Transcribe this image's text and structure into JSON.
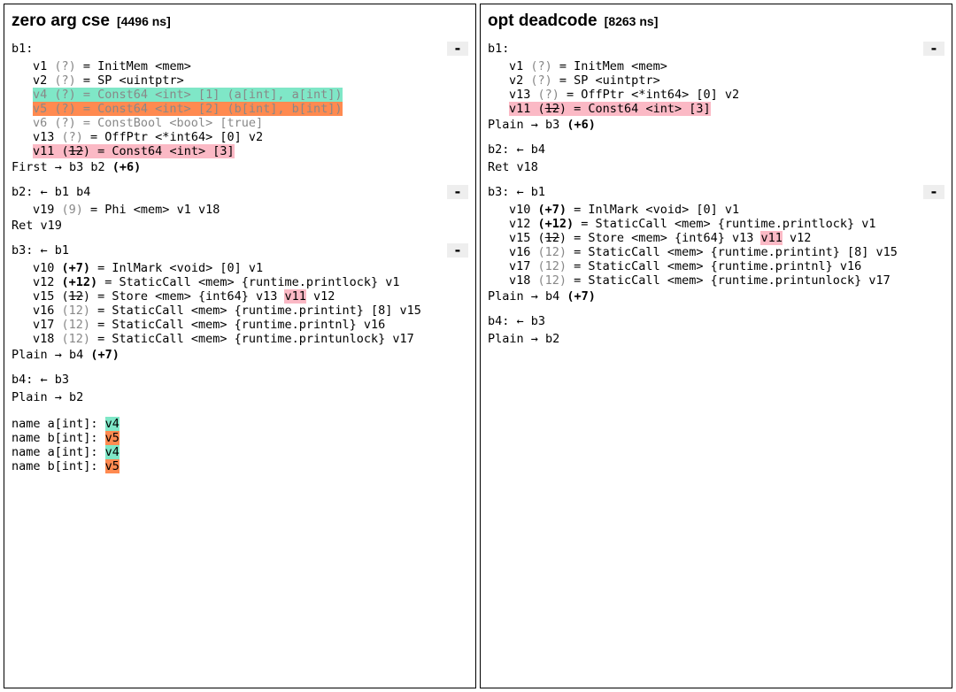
{
  "left": {
    "title": "zero arg cse",
    "time": "[4496 ns]",
    "b1": {
      "header": "b1:",
      "collapse": "-",
      "lines": [
        [
          {
            "t": "v1 "
          },
          {
            "t": "(?)",
            "dead": true
          },
          {
            "t": " = InitMem <mem>"
          }
        ],
        [
          {
            "t": "v2 "
          },
          {
            "t": "(?)",
            "dead": true
          },
          {
            "t": " = SP <uintptr>"
          }
        ],
        [
          {
            "t": "v4 (?) = Const64 <int> [1] (a[int], a[int])",
            "hl": "green",
            "dead": true
          }
        ],
        [
          {
            "t": "v5 (?) = Const64 <int> [2] (b[int], b[int])",
            "hl": "orange",
            "dead": true
          }
        ],
        [
          {
            "t": "v6 (?) = ConstBool <bool> [true]",
            "dead": true
          }
        ],
        [
          {
            "t": "v13 "
          },
          {
            "t": "(?)",
            "dead": true
          },
          {
            "t": " = OffPtr <*int64> [0] v2"
          }
        ],
        [
          {
            "t": "v11 ("
          },
          {
            "t": "12",
            "strike": true
          },
          {
            "t": ") = Const64 <int> [3]",
            "hl": "pink",
            "wrap": "pink"
          }
        ],
        [
          {
            "t": "First → b3 b2 ",
            "footer": true
          },
          {
            "t": "(+6)",
            "bold": true
          }
        ]
      ]
    },
    "b2": {
      "header": "b2: ← b1 b4",
      "collapse": "-",
      "lines": [
        [
          {
            "t": "v19 "
          },
          {
            "t": "(9)",
            "dead": true
          },
          {
            "t": " = Phi <mem> v1 v18"
          }
        ],
        [
          {
            "t": "Ret v19",
            "footer": true
          }
        ]
      ]
    },
    "b3": {
      "header": "b3: ← b1",
      "collapse": "-",
      "lines": [
        [
          {
            "t": "v10 "
          },
          {
            "t": "(+7)",
            "bold": true
          },
          {
            "t": " = InlMark <void> [0] v1"
          }
        ],
        [
          {
            "t": "v12 "
          },
          {
            "t": "(+12)",
            "bold": true
          },
          {
            "t": " = StaticCall <mem> {runtime.printlock} v1"
          }
        ],
        [
          {
            "t": "v15 ("
          },
          {
            "t": "12",
            "strike": true
          },
          {
            "t": ") = Store <mem> {int64} v13 "
          },
          {
            "t": "v11",
            "hl": "pink"
          },
          {
            "t": " v12"
          }
        ],
        [
          {
            "t": "v16 "
          },
          {
            "t": "(12)",
            "dead": true
          },
          {
            "t": " = StaticCall <mem> {runtime.printint} [8] v15"
          }
        ],
        [
          {
            "t": "v17 "
          },
          {
            "t": "(12)",
            "dead": true
          },
          {
            "t": " = StaticCall <mem> {runtime.printnl} v16"
          }
        ],
        [
          {
            "t": "v18 "
          },
          {
            "t": "(12)",
            "dead": true
          },
          {
            "t": " = StaticCall <mem> {runtime.printunlock} v17"
          }
        ],
        [
          {
            "t": "Plain → b4 ",
            "footer": true
          },
          {
            "t": "(+7)",
            "bold": true
          }
        ]
      ]
    },
    "b4": {
      "header": "b4: ← b3",
      "lines": [
        [
          {
            "t": "Plain → b2",
            "footer": true
          }
        ]
      ]
    },
    "names": [
      {
        "label": "name a[int]: ",
        "chip": "v4",
        "hl": "green"
      },
      {
        "label": "name b[int]: ",
        "chip": "v5",
        "hl": "orange"
      },
      {
        "label": "name a[int]: ",
        "chip": "v4",
        "hl": "green"
      },
      {
        "label": "name b[int]: ",
        "chip": "v5",
        "hl": "orange"
      }
    ]
  },
  "right": {
    "title": "opt deadcode",
    "time": "[8263 ns]",
    "b1": {
      "header": "b1:",
      "collapse": "-",
      "lines": [
        [
          {
            "t": "v1 "
          },
          {
            "t": "(?)",
            "dead": true
          },
          {
            "t": " = InitMem <mem>"
          }
        ],
        [
          {
            "t": "v2 "
          },
          {
            "t": "(?)",
            "dead": true
          },
          {
            "t": " = SP <uintptr>"
          }
        ],
        [
          {
            "t": "v13 "
          },
          {
            "t": "(?)",
            "dead": true
          },
          {
            "t": " = OffPtr <*int64> [0] v2"
          }
        ],
        [
          {
            "t": "v11 ("
          },
          {
            "t": "12",
            "strike": true
          },
          {
            "t": ") = Const64 <int> [3]",
            "hl": "pink",
            "wrap": "pink"
          }
        ],
        [
          {
            "t": "Plain → b3 ",
            "footer": true
          },
          {
            "t": "(+6)",
            "bold": true
          }
        ]
      ]
    },
    "b2": {
      "header": "b2: ← b4",
      "lines": [
        [
          {
            "t": "Ret v18",
            "footer": true
          }
        ]
      ]
    },
    "b3": {
      "header": "b3: ← b1",
      "collapse": "-",
      "lines": [
        [
          {
            "t": "v10 "
          },
          {
            "t": "(+7)",
            "bold": true
          },
          {
            "t": " = InlMark <void> [0] v1"
          }
        ],
        [
          {
            "t": "v12 "
          },
          {
            "t": "(+12)",
            "bold": true
          },
          {
            "t": " = StaticCall <mem> {runtime.printlock} v1"
          }
        ],
        [
          {
            "t": "v15 ("
          },
          {
            "t": "12",
            "strike": true
          },
          {
            "t": ") = Store <mem> {int64} v13 "
          },
          {
            "t": "v11",
            "hl": "pink"
          },
          {
            "t": " v12"
          }
        ],
        [
          {
            "t": "v16 "
          },
          {
            "t": "(12)",
            "dead": true
          },
          {
            "t": " = StaticCall <mem> {runtime.printint} [8] v15"
          }
        ],
        [
          {
            "t": "v17 "
          },
          {
            "t": "(12)",
            "dead": true
          },
          {
            "t": " = StaticCall <mem> {runtime.printnl} v16"
          }
        ],
        [
          {
            "t": "v18 "
          },
          {
            "t": "(12)",
            "dead": true
          },
          {
            "t": " = StaticCall <mem> {runtime.printunlock} v17"
          }
        ],
        [
          {
            "t": "Plain → b4 ",
            "footer": true
          },
          {
            "t": "(+7)",
            "bold": true
          }
        ]
      ]
    },
    "b4": {
      "header": "b4: ← b3",
      "lines": [
        [
          {
            "t": "Plain → b2",
            "footer": true
          }
        ]
      ]
    }
  }
}
